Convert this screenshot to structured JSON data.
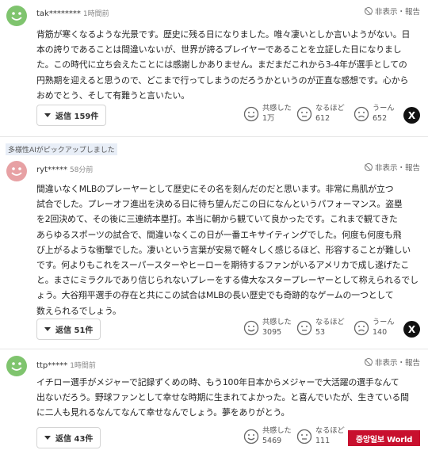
{
  "common": {
    "hide_report": "非表示・報告",
    "reaction_labels": [
      "共感した",
      "なるほど",
      "うーん"
    ],
    "x_label": "X"
  },
  "ai_badge": "多様性AIがピックアップしました",
  "comments": [
    {
      "user": "tak********",
      "ago": "1時間前",
      "lines": [
        "背筋が寒くなるような光景です。歴史に残る日になりました。唯々凄いとしか言いようがない。日",
        "本の誇りであることは間違いないが、世界が誇るプレイヤーであることを立証した日になりまし",
        "た。この時代に立ち会えたことには感謝しかありません。まだまだこれから3-4年が選手としての",
        "円熟期を迎えると思うので、どこまで行ってしまうのだろうかというのが正直な感想です。心から",
        "おめでとう、そして有難うと言いたい。"
      ],
      "reply": "返信 159件",
      "counts": [
        "1万",
        "612",
        "652"
      ]
    },
    {
      "user": "ryt*****",
      "ago": "58分前",
      "lines": [
        "間違いなくMLBのプレーヤーとして歴史にその名を刻んだのだと思います。非常に鳥肌が立つ",
        "試合でした。プレーオフ進出を決める日に待ち望んだこの日になんというパフォーマンス。盗塁",
        "を2回決めて、その後に三連続本塁打。本当に朝から観ていて良かったです。これまで観てきた",
        "あらゆるスポーツの試合で、間違いなくこの日が一番エキサイティングでした。何度も何度も飛",
        "び上がるような衝撃でした。凄いという言葉が安易で軽々しく感じるほど、形容することが難しい",
        "です。何よりもこれをスーパースターやヒーローを期待するファンがいるアメリカで成し遂げたこ",
        "と。まさにミラクルであり信じられないプレーをする偉大なスタープレーヤーとして称えられるでし",
        "ょう。大谷翔平選手の存在と共にこの試合はMLBの長い歴史でも奇跡的なゲームの一つとして",
        "数えられるでしょう。"
      ],
      "reply": "返信 51件",
      "counts": [
        "3095",
        "53",
        "140"
      ]
    },
    {
      "user": "ttp*****",
      "ago": "1時間前",
      "lines": [
        "イチロー選手がメジャーで記録ずくめの時、もう100年日本からメジャーで大活躍の選手なんて",
        "出ないだろう。野球ファンとして幸せな時期に生まれてよかった。と喜んでいたが、生きている間",
        "に二人も見れるなんてなんて幸せなんでしょう。夢をありがとう。"
      ],
      "reply": "返信 43件",
      "counts": [
        "5469",
        "111",
        ""
      ]
    }
  ],
  "watermark": "중앙일보 World",
  "colors": {
    "avatar_green": "#7fc46e",
    "avatar_pink": "#e7a1a4",
    "watermark_red": "#c8102e",
    "ai_badge_bg": "#e8eef7"
  }
}
